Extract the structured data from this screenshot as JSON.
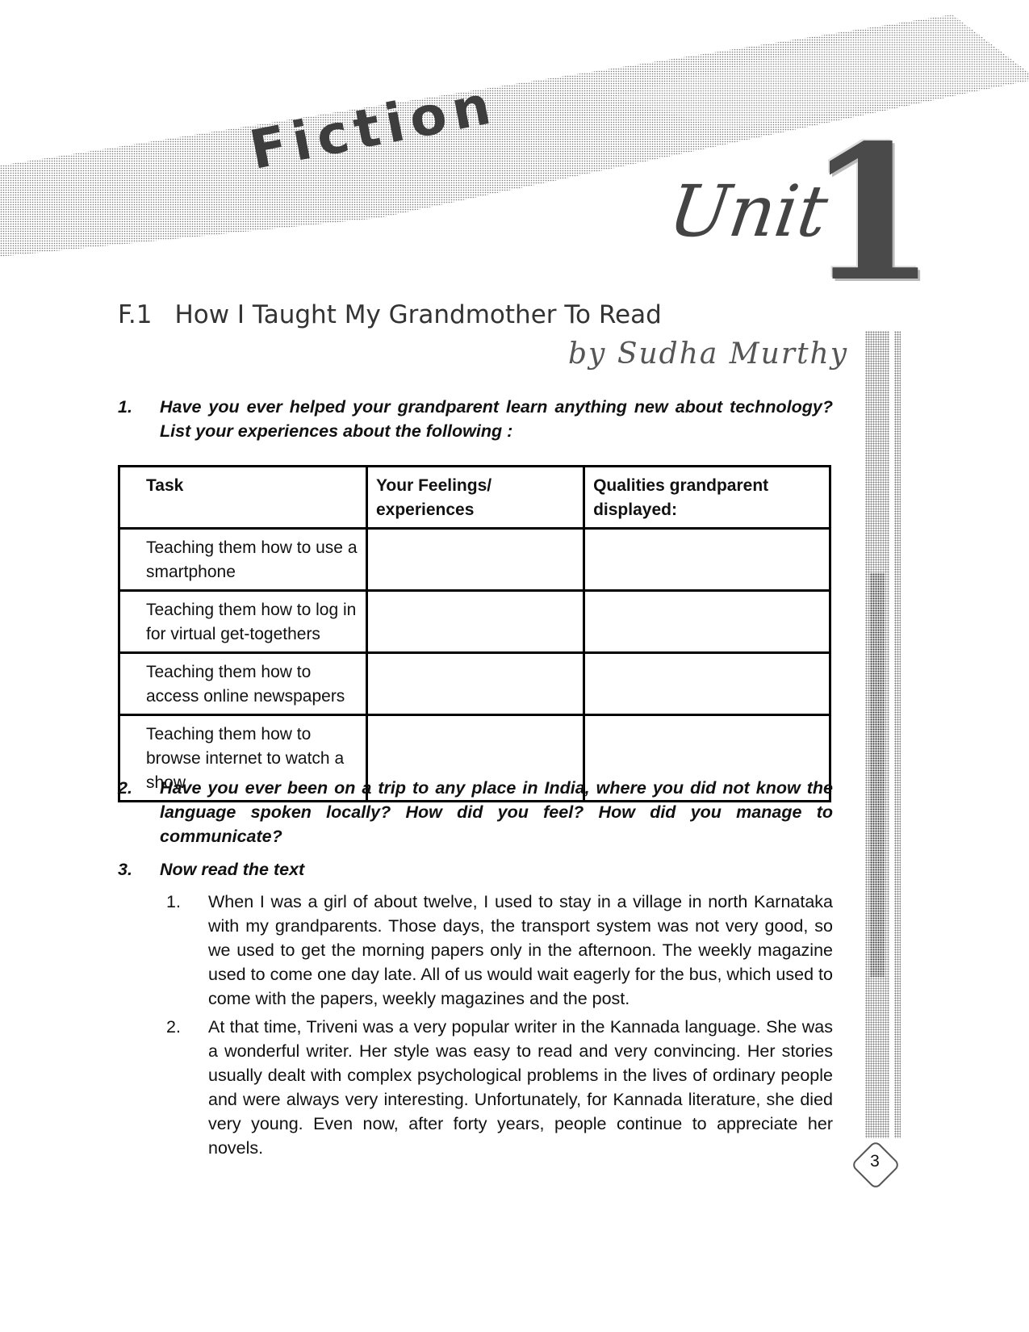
{
  "banner": {
    "section_label": "Fiction",
    "unit_word": "Unit",
    "unit_number": "1"
  },
  "chapter": {
    "code": "F.1",
    "title": "How I Taught My Grandmother To Read",
    "author": "by Sudha Murthy"
  },
  "questions": [
    {
      "number": "1.",
      "text": "Have you ever helped your grandparent learn anything new about technology? List your experiences about the following :"
    },
    {
      "number": "2.",
      "text": "Have you ever been on a trip to any place in India, where you did not know the language spoken locally? How did you feel? How did you manage to communicate?"
    },
    {
      "number": "3.",
      "text": "Now read the text"
    }
  ],
  "table": {
    "headers": [
      "Task",
      "Your Feelings/ experiences",
      "Qualities grandparent displayed:"
    ],
    "rows": [
      [
        "Teaching them how to use a smartphone",
        "",
        ""
      ],
      [
        "Teaching them how to log in for virtual get-togethers",
        "",
        ""
      ],
      [
        "Teaching them how to access online newspapers",
        "",
        ""
      ],
      [
        "Teaching them how to browse internet to watch a show",
        "",
        ""
      ]
    ]
  },
  "paragraphs": [
    {
      "number": "1.",
      "text": "When I was a girl of about twelve, I used to stay in a village in north Karnataka with my grandparents. Those days, the transport system was not very good, so we used to get the morning papers only in the afternoon. The weekly magazine used to come one day late. All of us would wait eagerly for the bus, which used to come with the papers, weekly magazines and the post."
    },
    {
      "number": "2.",
      "text": "At that time, Triveni was a very popular writer in the Kannada language. She was a wonderful writer. Her style was easy to read and very convincing. Her stories usually dealt with complex psychological problems in the lives of ordinary people and were always very interesting. Unfortunately, for Kannada literature, she died very young. Even now, after forty years, people continue to appreciate her novels."
    }
  ],
  "page_number": "3"
}
